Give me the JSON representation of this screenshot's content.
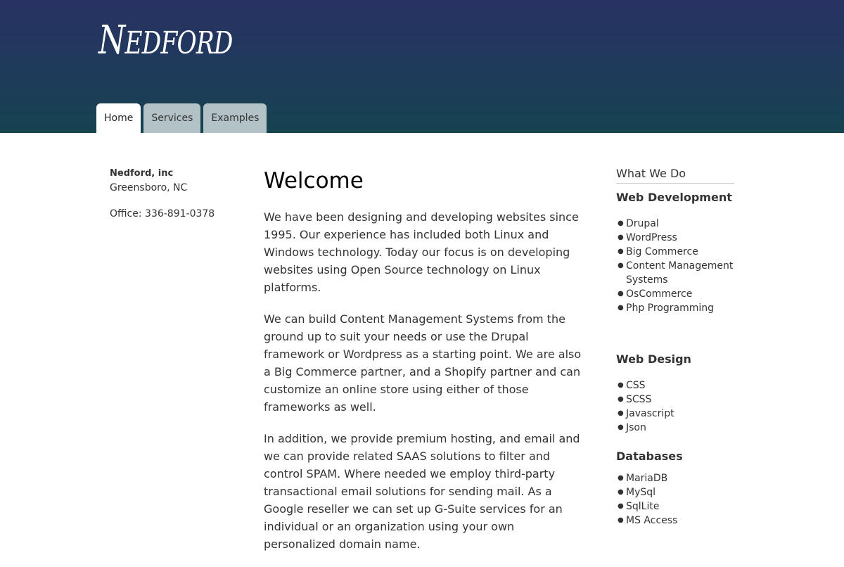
{
  "header": {
    "logo_first": "N",
    "logo_rest": "EDFORD",
    "tabs": [
      {
        "label": "Home",
        "active": true
      },
      {
        "label": "Services",
        "active": false
      },
      {
        "label": "Examples",
        "active": false
      }
    ]
  },
  "contact": {
    "company": "Nedford, inc",
    "city": "Greensboro, NC",
    "office": "Office: 336-891-0378"
  },
  "main": {
    "title": "Welcome",
    "paragraphs": [
      "We have been designing and developing websites since 1995. Our experience has included both Linux and Windows technology. Today our focus is on developing websites using Open Source technology on Linux platforms.",
      "We can build Content Management Systems from the ground up to suit your needs or use the Drupal framework or Wordpress as a starting point. We are also a Big Commerce partner, and a Shopify partner and can customize an online store using either of those frameworks as well.",
      "In addition, we provide premium hosting, and email and we can provide related SAAS solutions to filter and control SPAM. Where needed we employ third-party transactional email solutions for sending mail. As a Google reseller we can set up G-Suite services for an individual or an organization using your own personalized domain name."
    ]
  },
  "sidebar": {
    "title": "What We Do",
    "groups": [
      {
        "heading": "Web Development",
        "items": [
          "Drupal",
          "WordPress",
          "Big Commerce",
          "Content Management Systems",
          "OsCommerce",
          "Php Programming"
        ]
      },
      {
        "heading": "Web Design",
        "items": [
          "CSS",
          "SCSS",
          "Javascript",
          "Json"
        ]
      },
      {
        "heading": "Databases",
        "items": [
          "MariaDB",
          "MySql",
          "SqlLite",
          "MS Access"
        ]
      }
    ]
  },
  "colors": {
    "header_top": "#283263",
    "header_bottom": "#15434f",
    "tab_inactive": "#b3c2c7"
  }
}
